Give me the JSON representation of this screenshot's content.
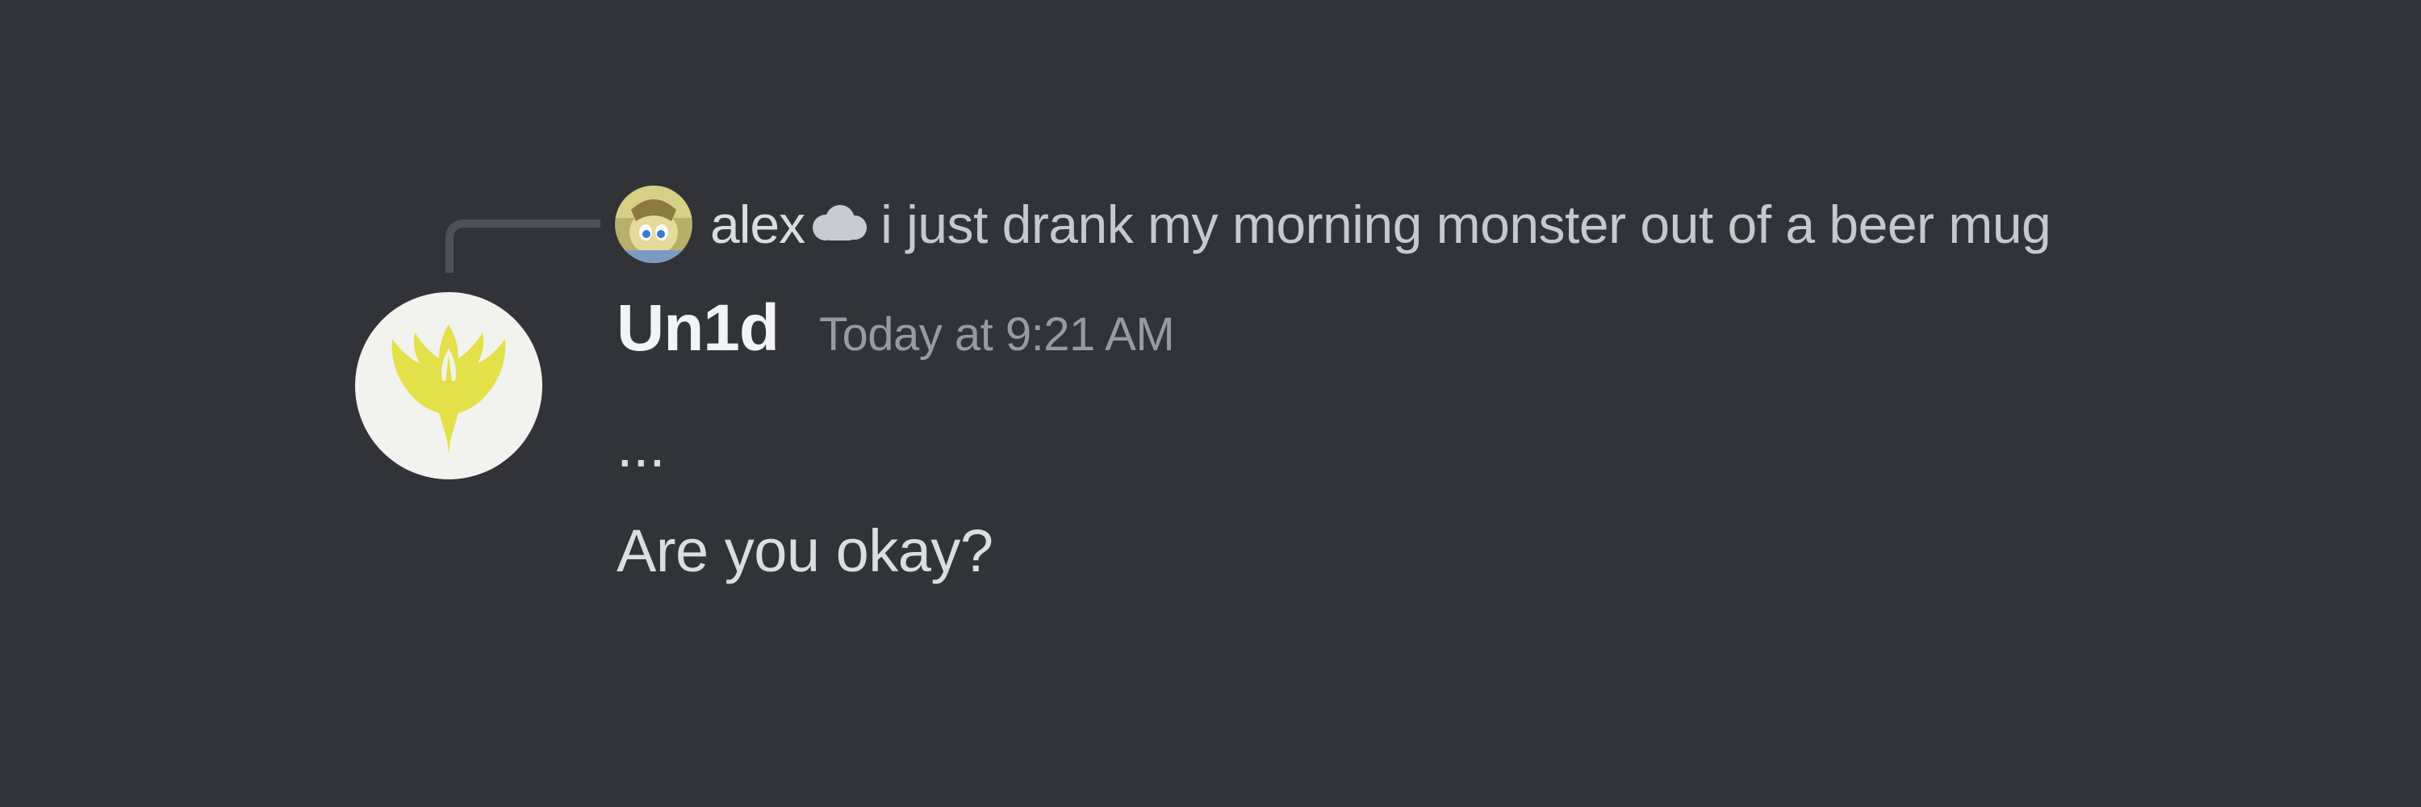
{
  "reply": {
    "author": "alex",
    "author_icon": "cloud-icon",
    "text": "i just drank my morning monster out of a beer mug"
  },
  "message": {
    "author": "Un1d",
    "timestamp": "Today at 9:21 AM",
    "lines": [
      "...",
      "Are you okay?"
    ]
  },
  "colors": {
    "background": "#313338",
    "username": "#f2f3f5",
    "timestamp": "#949ba4",
    "text": "#dbdee1",
    "reply_spine": "#4e5058",
    "avatar_bg": "#f2f2ee",
    "avatar_emblem": "#e3e04a"
  }
}
